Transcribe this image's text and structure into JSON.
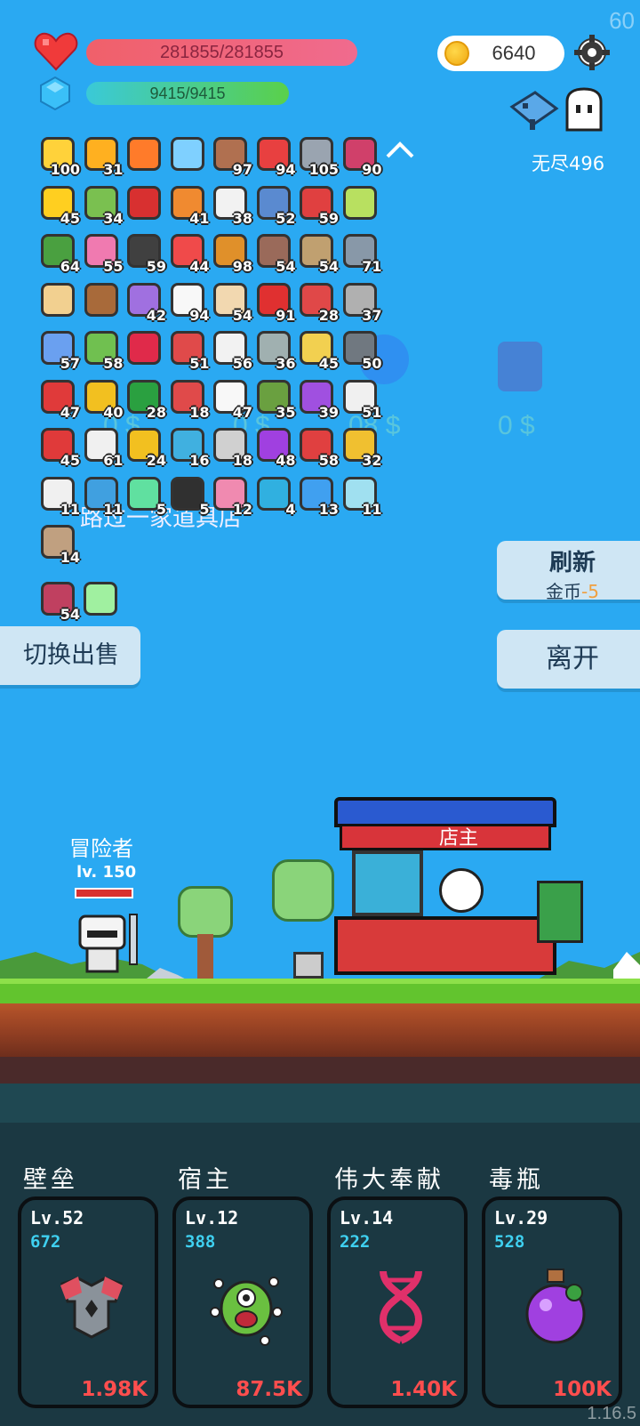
{
  "hud": {
    "fps": "60",
    "hp": "281855/281855",
    "mp": "9415/9415",
    "coins": "6640",
    "mode": "无尽496"
  },
  "items": [
    {
      "c": "#ffd23a",
      "n": "100"
    },
    {
      "c": "#ffb020",
      "n": "31"
    },
    {
      "c": "#ff7b2a",
      "n": ""
    },
    {
      "c": "#7fd0ff",
      "n": ""
    },
    {
      "c": "#b07050",
      "n": "97"
    },
    {
      "c": "#e84040",
      "n": "94"
    },
    {
      "c": "#9aa4b0",
      "n": "105"
    },
    {
      "c": "#d0406a",
      "n": "90"
    },
    {
      "c": "#ffcf20",
      "n": "45"
    },
    {
      "c": "#7ac050",
      "n": "34"
    },
    {
      "c": "#d83030",
      "n": ""
    },
    {
      "c": "#f08a30",
      "n": "41"
    },
    {
      "c": "#f2f2f2",
      "n": "38"
    },
    {
      "c": "#5a8ad0",
      "n": "52"
    },
    {
      "c": "#e04040",
      "n": "59"
    },
    {
      "c": "#b8e060",
      "n": ""
    },
    {
      "c": "#4aa040",
      "n": "64"
    },
    {
      "c": "#f07ab0",
      "n": "55"
    },
    {
      "c": "#404040",
      "n": "59"
    },
    {
      "c": "#f04a4a",
      "n": "44"
    },
    {
      "c": "#e0902a",
      "n": "98"
    },
    {
      "c": "#9a6a5a",
      "n": "54"
    },
    {
      "c": "#c0a070",
      "n": "54"
    },
    {
      "c": "#8898a8",
      "n": "71"
    },
    {
      "c": "#f2d090",
      "n": ""
    },
    {
      "c": "#a86a3a",
      "n": ""
    },
    {
      "c": "#a070e0",
      "n": "42"
    },
    {
      "c": "#f8f8f8",
      "n": "94"
    },
    {
      "c": "#f2d8b0",
      "n": "54"
    },
    {
      "c": "#e03030",
      "n": "91"
    },
    {
      "c": "#e04848",
      "n": "28"
    },
    {
      "c": "#b0b0b0",
      "n": "37"
    },
    {
      "c": "#6aa0f0",
      "n": "57"
    },
    {
      "c": "#70c050",
      "n": "58"
    },
    {
      "c": "#e02a4a",
      "n": ""
    },
    {
      "c": "#e04a4a",
      "n": "51"
    },
    {
      "c": "#f2f2f2",
      "n": "56"
    },
    {
      "c": "#a0b0b0",
      "n": "36"
    },
    {
      "c": "#f2d050",
      "n": "45"
    },
    {
      "c": "#707880",
      "n": "50"
    },
    {
      "c": "#e03a3a",
      "n": "47"
    },
    {
      "c": "#f2c020",
      "n": "40"
    },
    {
      "c": "#2aa040",
      "n": "28"
    },
    {
      "c": "#e04a4a",
      "n": "18"
    },
    {
      "c": "#f8f8f8",
      "n": "47"
    },
    {
      "c": "#6aa040",
      "n": "35"
    },
    {
      "c": "#a050e0",
      "n": "39"
    },
    {
      "c": "#f0f0f0",
      "n": "51"
    },
    {
      "c": "#e03a3a",
      "n": "45"
    },
    {
      "c": "#f0f0f0",
      "n": "61"
    },
    {
      "c": "#f2c020",
      "n": "24"
    },
    {
      "c": "#40b0e0",
      "n": "16"
    },
    {
      "c": "#d0d0d0",
      "n": "18"
    },
    {
      "c": "#a040e0",
      "n": "48"
    },
    {
      "c": "#e04040",
      "n": "58"
    },
    {
      "c": "#f0c030",
      "n": "32"
    },
    {
      "c": "#f0f0f0",
      "n": "11"
    },
    {
      "c": "#40a0e0",
      "n": "11"
    },
    {
      "c": "#60e0a0",
      "n": "5"
    },
    {
      "c": "#303030",
      "n": "5"
    },
    {
      "c": "#f08ab0",
      "n": "12"
    },
    {
      "c": "#30b0e0",
      "n": "4"
    },
    {
      "c": "#40a0f0",
      "n": "13"
    },
    {
      "c": "#a0e0f0",
      "n": "11"
    },
    {
      "c": "#c0a080",
      "n": "14"
    }
  ],
  "equipped": [
    {
      "c": "#c04060",
      "n": "54"
    },
    {
      "c": "#a0f0a0",
      "n": ""
    }
  ],
  "shop": {
    "title": "路过一家道具店",
    "prices": [
      "0 $",
      "0 $",
      "08 $",
      "0 $"
    ],
    "refresh": "刷新",
    "refresh_cost_label": "金币",
    "refresh_cost": "-5",
    "leave": "离开",
    "switch": "切换出售",
    "keeper": "店主"
  },
  "adventurer": {
    "name": "冒险者",
    "level": "lv. 150"
  },
  "skills": [
    {
      "title": "壁垒",
      "lv": "Lv.52",
      "val": "672",
      "cost": "1.98K"
    },
    {
      "title": "宿主",
      "lv": "Lv.12",
      "val": "388",
      "cost": "87.5K"
    },
    {
      "title": "伟大奉献",
      "lv": "Lv.14",
      "val": "222",
      "cost": "1.40K"
    },
    {
      "title": "毒瓶",
      "lv": "Lv.29",
      "val": "528",
      "cost": "100K"
    }
  ],
  "version": "1.16.5"
}
